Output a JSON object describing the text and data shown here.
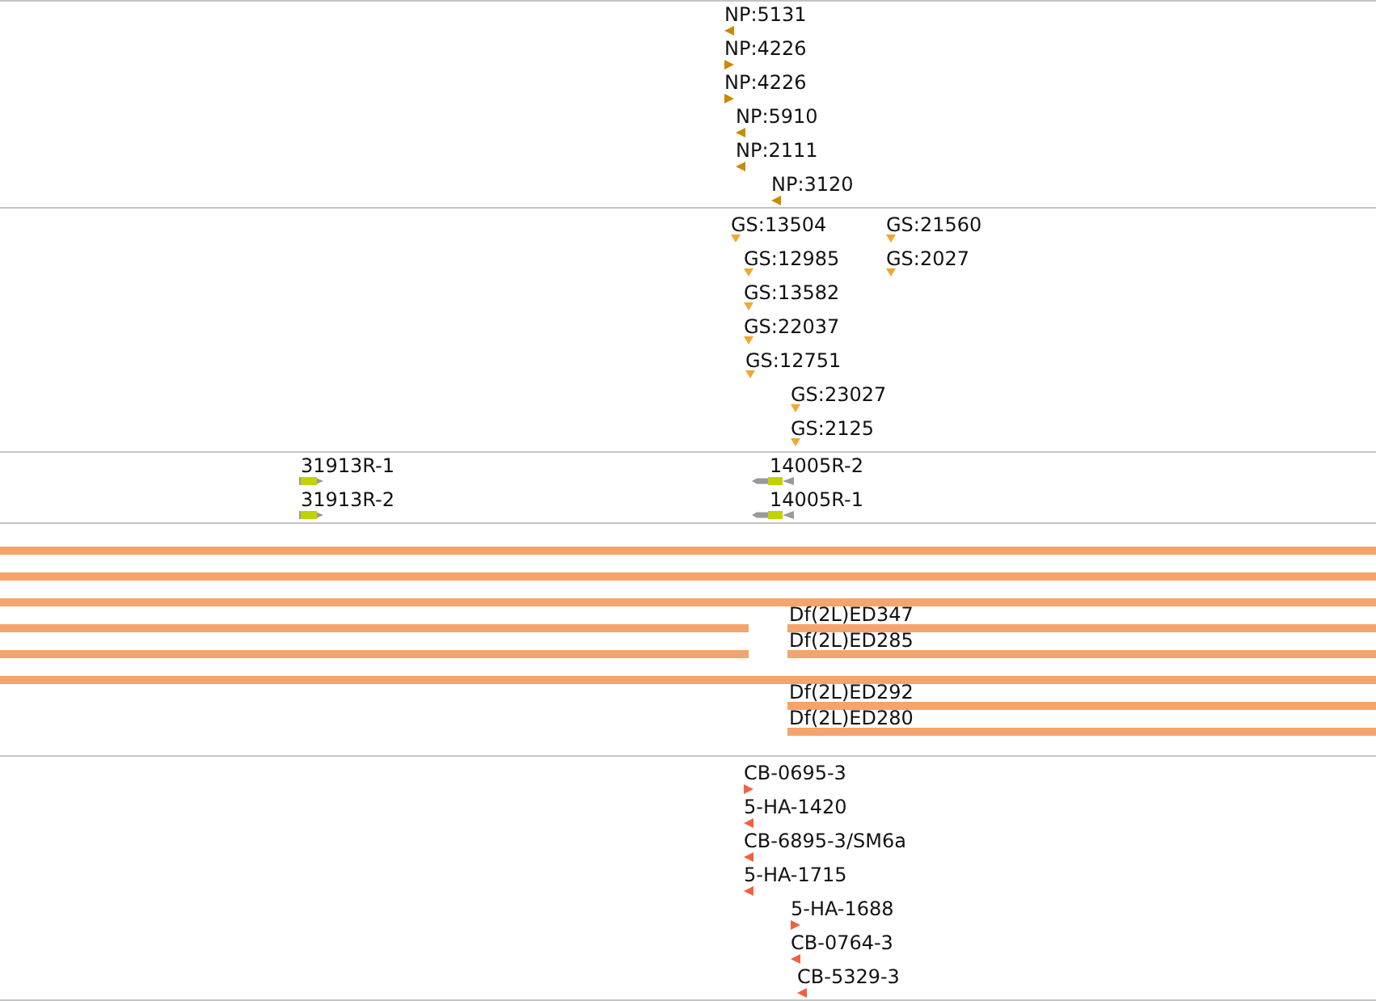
{
  "tracks": [
    {
      "kind": "markers",
      "color": "#cc8800",
      "features": [
        {
          "label": "NP:5131",
          "reverse": true
        },
        {
          "label": "NP:4226",
          "reverse": false
        },
        {
          "label": "NP:4226",
          "reverse": false
        },
        {
          "label": "NP:5910",
          "reverse": true
        },
        {
          "label": "NP:2111",
          "reverse": true
        },
        {
          "label": "NP:3120",
          "reverse": true
        }
      ]
    },
    {
      "kind": "sites",
      "color": "#f0a830",
      "features": [
        {
          "label": "GS:13504"
        },
        {
          "label": "GS:21560"
        },
        {
          "label": "GS:12985"
        },
        {
          "label": "GS:2027"
        },
        {
          "label": "GS:13582"
        },
        {
          "label": "GS:22037"
        },
        {
          "label": "GS:12751"
        },
        {
          "label": "GS:23027"
        },
        {
          "label": "GS:2125"
        }
      ]
    },
    {
      "kind": "amplicons",
      "features": [
        {
          "label": "31913R-1",
          "reverse": false
        },
        {
          "label": "14005R-2",
          "reverse": true
        },
        {
          "label": "31913R-2",
          "reverse": false
        },
        {
          "label": "14005R-1",
          "reverse": true
        }
      ]
    },
    {
      "kind": "bars",
      "color": "#f4a46c",
      "features": [
        {
          "kind": "deficiency"
        },
        {
          "kind": "deficiency"
        },
        {
          "kind": "deficiency"
        },
        {
          "kind": "deficiency"
        },
        {
          "kind": "deficiency",
          "label": "Df(2L)ED347"
        },
        {
          "kind": "deficiency"
        },
        {
          "kind": "deficiency",
          "label": "Df(2L)ED285"
        },
        {
          "kind": "deficiency"
        },
        {
          "kind": "deficiency",
          "label": "Df(2L)ED292"
        },
        {
          "kind": "deficiency",
          "label": "Df(2L)ED280"
        }
      ]
    },
    {
      "kind": "markers",
      "color": "#f46040",
      "features": [
        {
          "label": "CB-0695-3",
          "reverse": false
        },
        {
          "label": "5-HA-1420",
          "reverse": true
        },
        {
          "label": "CB-6895-3/SM6a",
          "reverse": true
        },
        {
          "label": "5-HA-1715",
          "reverse": true
        },
        {
          "label": "5-HA-1688",
          "reverse": false
        },
        {
          "label": "CB-0764-3",
          "reverse": true
        },
        {
          "label": "CB-5329-3",
          "reverse": true
        }
      ]
    }
  ]
}
